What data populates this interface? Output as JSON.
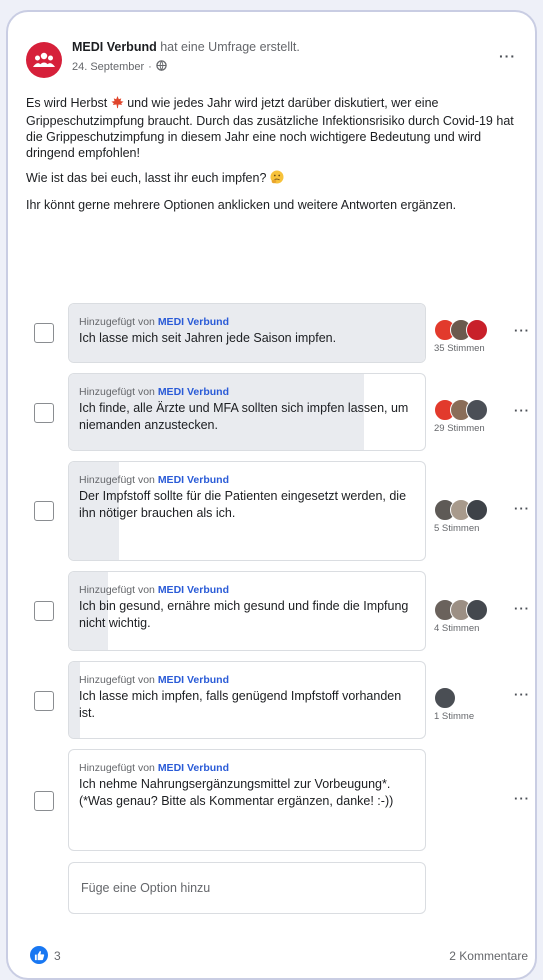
{
  "post": {
    "org_name": "MEDI Verbund",
    "action_text": " hat eine Umfrage erstellt.",
    "date": "24. September",
    "date_separator": "·",
    "more_label": "···",
    "text_1a": "Es wird Herbst ",
    "text_1b": " und wie jedes Jahr wird jetzt darüber diskutiert, wer eine Grippeschutzimpfung braucht. Durch das zusätzliche Infektionsrisiko durch Covid-19 hat die Grippeschutzimpfung in diesem Jahr eine noch wichtigere Bedeutung und wird dringend empfohlen!",
    "text_2": "Wie ist das bei euch, lasst ihr euch impfen? ",
    "text_3": "Ihr könnt gerne mehrere Optionen anklicken und weitere Antworten ergänzen.",
    "icons": {
      "avatar": "group-icon",
      "audience": "globe-icon",
      "leaf": "maple-leaf-icon",
      "face": "thinking-face-icon"
    }
  },
  "poll": {
    "added_prefix": "Hinzugefügt von ",
    "options": [
      {
        "added_by": "MEDI Verbund",
        "text": "Ich lasse mich seit Jahren jede Saison impfen.",
        "votes": "35 Stimmen",
        "fill": 1.0
      },
      {
        "added_by": "MEDI Verbund",
        "text": "Ich finde, alle Ärzte und MFA sollten sich impfen lassen, um niemanden anzustecken.",
        "votes": "29 Stimmen",
        "fill": 0.83
      },
      {
        "added_by": "MEDI Verbund",
        "text": "Der Impfstoff sollte für die Patienten eingesetzt werden, die ihn nötiger brauchen als ich.",
        "votes": "5 Stimmen",
        "fill": 0.14
      },
      {
        "added_by": "MEDI Verbund",
        "text": "Ich bin gesund, ernähre mich gesund und finde die Impfung nicht wichtig.",
        "votes": "4 Stimmen",
        "fill": 0.11
      },
      {
        "added_by": "MEDI Verbund",
        "text": "Ich lasse mich impfen, falls genügend Impfstoff vorhanden ist.",
        "votes": "1 Stimme",
        "fill": 0.03
      },
      {
        "added_by": "MEDI Verbund",
        "text": "Ich nehme Nahrungsergänzungsmittel zur Vorbeugung*. (*Was genau? Bitte als Kommentar ergänzen, danke! :-))",
        "votes": "",
        "fill": 0.0
      }
    ],
    "add_option_placeholder": "Füge eine Option hinzu"
  },
  "footer": {
    "reaction_count": "3",
    "comments": "2 Kommentare",
    "reaction_icon": "thumbs-up-icon"
  },
  "colors": {
    "brand": "#d6203a",
    "link": "#2a5bd7",
    "like": "#1877f2"
  }
}
